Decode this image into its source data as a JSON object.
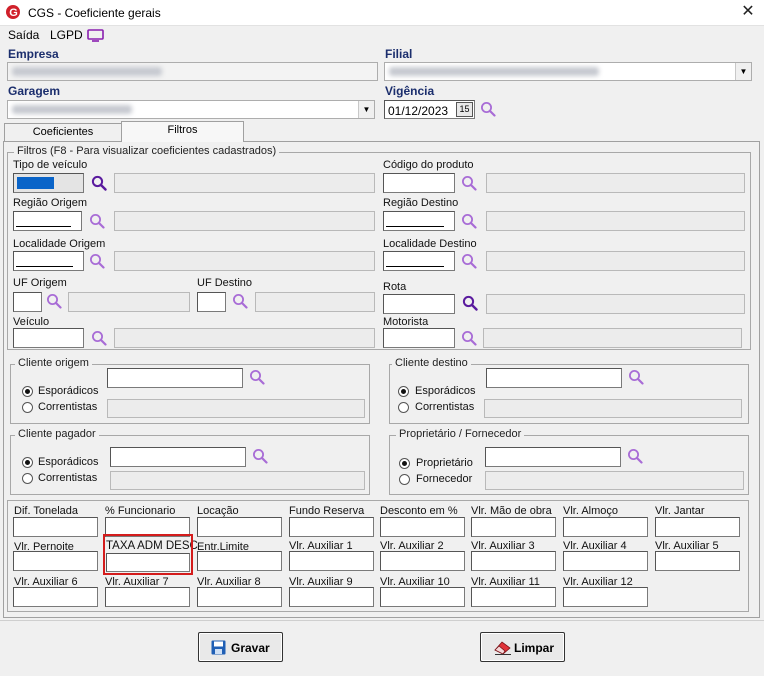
{
  "window": {
    "title": "CGS - Coeficiente gerais",
    "close_glyph": "✕"
  },
  "menu": {
    "saida": "Saída",
    "lgpd": "LGPD"
  },
  "header": {
    "empresa_label": "Empresa",
    "filial_label": "Filial",
    "garagem_label": "Garagem",
    "vigencia_label": "Vigência",
    "vigencia_value": "01/12/2023",
    "calendar_glyph": "15"
  },
  "tabs": [
    {
      "label": "Coeficientes"
    },
    {
      "label": "Filtros"
    }
  ],
  "filtros": {
    "legend": "Filtros (F8 - Para visualizar coeficientes cadastrados)",
    "tipo_veiculo": "Tipo de veículo",
    "codigo_produto": "Código do produto",
    "regiao_origem": "Região Origem",
    "regiao_destino": "Região Destino",
    "localidade_origem": "Localidade Origem",
    "localidade_destino": "Localidade Destino",
    "uf_origem": "UF Origem",
    "uf_destino": "UF Destino",
    "rota": "Rota",
    "veiculo": "Veículo",
    "motorista": "Motorista"
  },
  "cliente_origem": {
    "legend": "Cliente origem",
    "opt1": "Esporádicos",
    "opt2": "Correntistas"
  },
  "cliente_destino": {
    "legend": "Cliente destino",
    "opt1": "Esporádicos",
    "opt2": "Correntistas"
  },
  "cliente_pagador": {
    "legend": "Cliente pagador",
    "opt1": "Esporádicos",
    "opt2": "Correntistas"
  },
  "proprietario": {
    "legend": "Proprietário / Fornecedor",
    "opt1": "Proprietário",
    "opt2": "Fornecedor"
  },
  "valores": {
    "row1": [
      "Dif. Tonelada",
      "% Funcionario",
      "Locação",
      "Fundo Reserva",
      "Desconto em %",
      "Vlr. Mão de obra",
      "Vlr. Almoço",
      "Vlr. Jantar"
    ],
    "row2": [
      "Vlr. Pernoite",
      "TAXA ADM DESC",
      "Entr.Limite",
      "Vlr. Auxiliar 1",
      "Vlr. Auxiliar 2",
      "Vlr. Auxiliar 3",
      "Vlr. Auxiliar 4",
      "Vlr. Auxiliar 5"
    ],
    "row3": [
      "Vlr. Auxiliar 6",
      "Vlr. Auxiliar 7",
      "Vlr. Auxiliar 8",
      "Vlr. Auxiliar 9",
      "Vlr. Auxiliar 10",
      "Vlr. Auxiliar 11",
      "Vlr. Auxiliar 12"
    ]
  },
  "buttons": {
    "gravar": "Gravar",
    "limpar": "Limpar"
  },
  "colors": {
    "accent": "#1b2e6d",
    "highlight": "#d41c1c",
    "selection": "#0a64c8",
    "lupa": "#8a3fc9"
  }
}
